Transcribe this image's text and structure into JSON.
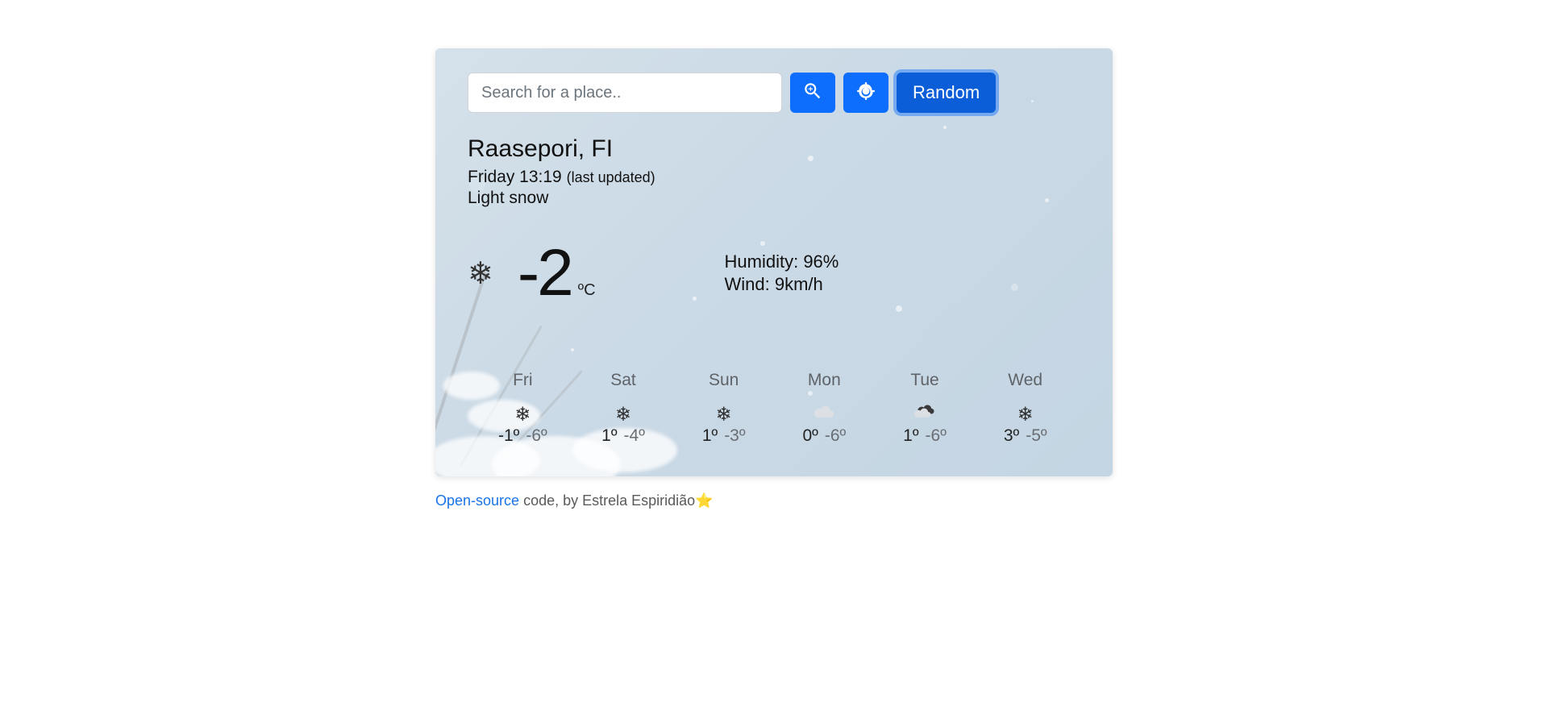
{
  "search": {
    "placeholder": "Search for a place.."
  },
  "buttons": {
    "random": "Random"
  },
  "location": "Raasepori, FI",
  "updated": {
    "prefix": "Friday 13:19 ",
    "suffix": "(last updated)"
  },
  "condition": "Light snow",
  "current": {
    "temp": "-2",
    "unit": "ºC",
    "icon": "snowflake"
  },
  "stats": {
    "humidity_label": "Humidity: ",
    "humidity": "96%",
    "wind_label": "Wind: ",
    "wind": "9km/h"
  },
  "forecast": [
    {
      "day": "Fri",
      "icon": "snowflake",
      "hi": "-1º",
      "lo": "-6º"
    },
    {
      "day": "Sat",
      "icon": "snowflake",
      "hi": "1º",
      "lo": "-4º"
    },
    {
      "day": "Sun",
      "icon": "snowflake",
      "hi": "1º",
      "lo": "-3º"
    },
    {
      "day": "Mon",
      "icon": "cloud",
      "hi": "0º",
      "lo": "-6º"
    },
    {
      "day": "Tue",
      "icon": "overcast",
      "hi": "1º",
      "lo": "-6º"
    },
    {
      "day": "Wed",
      "icon": "snowflake",
      "hi": "3º",
      "lo": "-5º"
    }
  ],
  "footer": {
    "link": "Open-source",
    "rest": " code, by Estrela Espiridião",
    "star": "⭐"
  }
}
